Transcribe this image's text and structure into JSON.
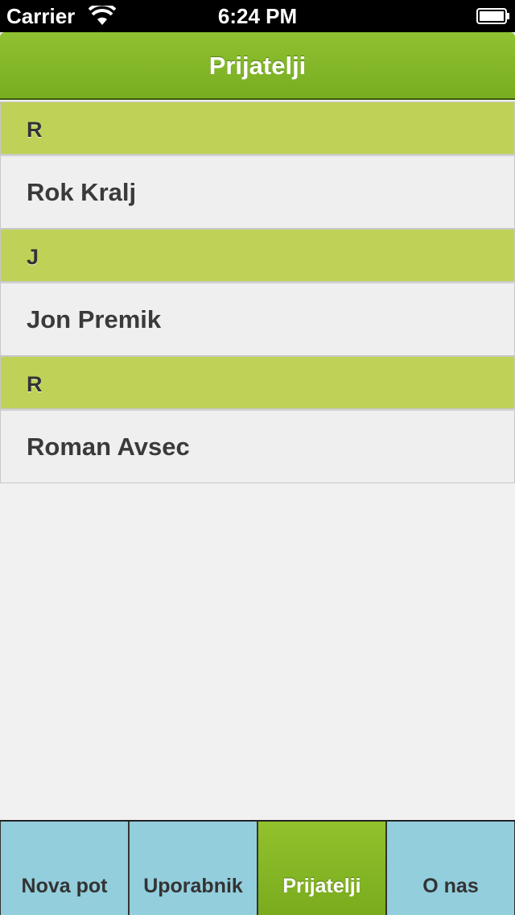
{
  "status_bar": {
    "carrier": "Carrier",
    "time": "6:24 PM",
    "wifi_icon": "wifi-icon",
    "battery_icon": "battery-icon"
  },
  "nav_bar": {
    "title": "Prijatelji",
    "color": "#85b82a"
  },
  "friends_list": {
    "sections": [
      {
        "header": "R",
        "items": [
          "Rok Kralj"
        ]
      },
      {
        "header": "J",
        "items": [
          "Jon Premik"
        ]
      },
      {
        "header": "R",
        "items": [
          "Roman Avsec"
        ]
      }
    ],
    "section_color": "#bfd257",
    "row_color": "#efefef"
  },
  "tab_bar": {
    "tabs": [
      {
        "label": "Nova pot",
        "active": false
      },
      {
        "label": "Uporabnik",
        "active": false
      },
      {
        "label": "Prijatelji",
        "active": true
      },
      {
        "label": "O nas",
        "active": false
      }
    ],
    "inactive_color": "#93cedd",
    "active_color": "#85b82a"
  }
}
